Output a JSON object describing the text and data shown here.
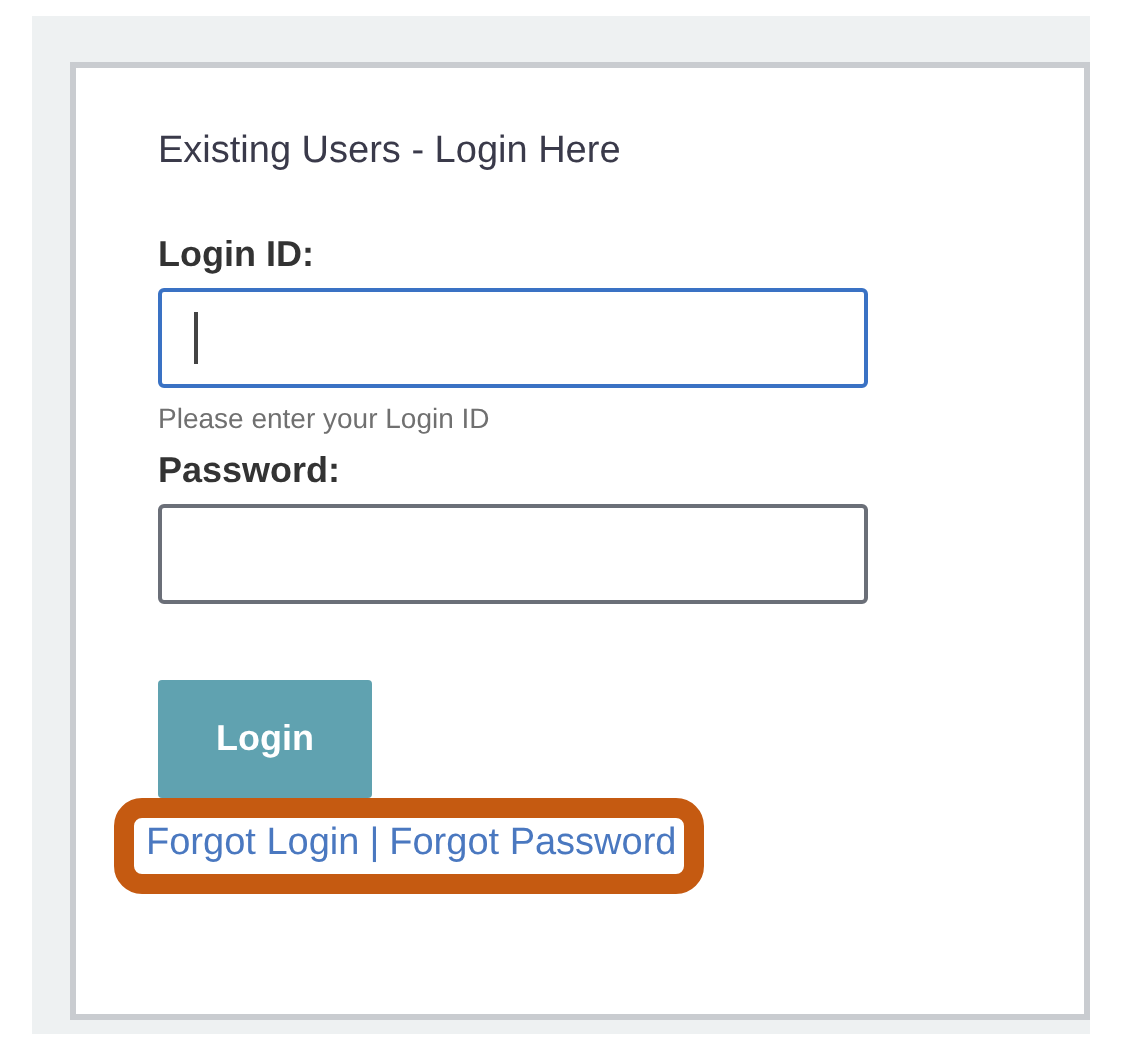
{
  "heading": "Existing Users - Login Here",
  "fields": [
    {
      "label": "Login ID:",
      "focused": true,
      "hint": "Please enter your Login ID"
    },
    {
      "label": "Password:",
      "focused": false
    }
  ],
  "button": "Login",
  "links": {
    "highlighted": true,
    "separator": "|",
    "items": [
      "Forgot Login",
      "Forgot Password"
    ]
  }
}
